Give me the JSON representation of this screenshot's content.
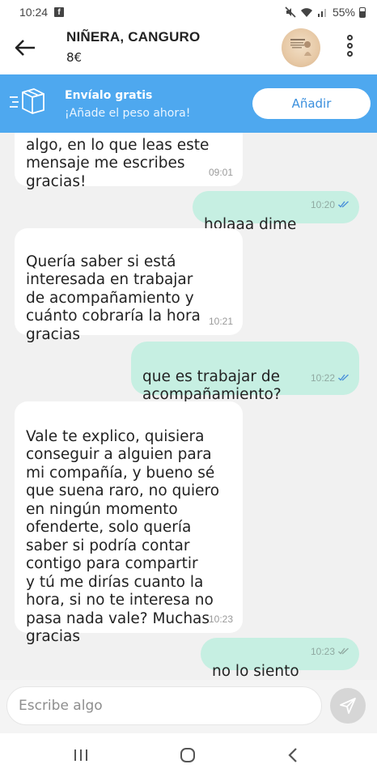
{
  "status_bar": {
    "time": "10:24",
    "battery": "55%",
    "facebook_badge": "f"
  },
  "header": {
    "title": "NIÑERA, CANGURO",
    "price": "8€"
  },
  "shipping_banner": {
    "title": "Envíalo gratis",
    "subtitle": "¡Añade el peso ahora!",
    "add_button": "Añadir",
    "color": "#4ea8ef"
  },
  "messages": [
    {
      "direction": "incoming",
      "text": "algo, en lo que leas este\nmensaje me escribes\ngracias!",
      "time": "09:01"
    },
    {
      "direction": "outgoing",
      "text": "holaaa dime",
      "time": "10:20",
      "read": true
    },
    {
      "direction": "incoming",
      "text": "Quería saber si está\ninteresada en trabajar\nde acompañamiento y\ncuánto cobraría la hora\ngracias",
      "time": "10:21"
    },
    {
      "direction": "outgoing",
      "text": "que es trabajar de\nacompañamiento?",
      "time": "10:22",
      "read": true
    },
    {
      "direction": "incoming",
      "text": "Vale te explico, quisiera\nconseguir a alguien para\nmi compañía, y bueno sé\nque suena raro, no quiero\nen ningún momento\nofenderte, solo quería\nsaber si podría contar\ncontigo para compartir\ny tú me dirías cuanto la\nhora, si no te interesa no\npasa nada vale? Muchas\ngracias",
      "time": "10:23"
    },
    {
      "direction": "outgoing",
      "text": "no lo siento",
      "time": "10:23",
      "read": false
    }
  ],
  "composer": {
    "placeholder": "Escribe algo"
  },
  "icons": {
    "back": "arrow-left-icon",
    "more": "more-vertical-icon",
    "ship": "package-icon",
    "send": "paper-plane-icon",
    "nav_recent": "recent-apps-icon",
    "nav_home": "home-icon",
    "nav_back": "chevron-left-icon"
  },
  "colors": {
    "outgoing_bubble": "#c6efe2",
    "incoming_bubble": "#ffffff",
    "read_ticks": "#4a90d9"
  }
}
